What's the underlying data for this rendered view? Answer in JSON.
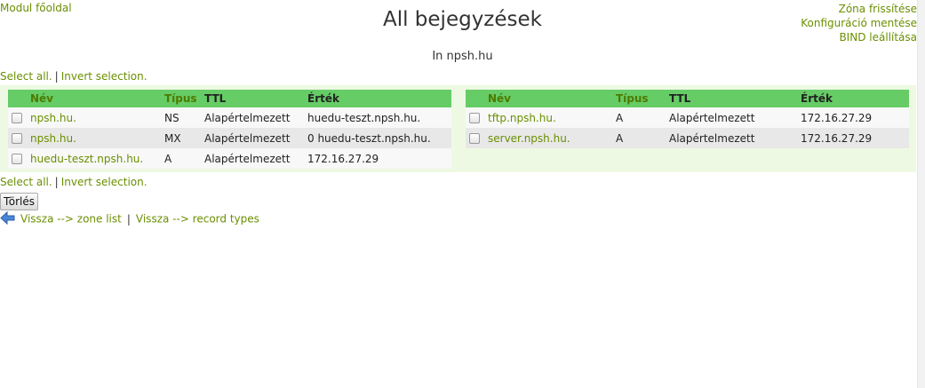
{
  "header": {
    "module_home": "Modul főoldal",
    "title": "All bejegyzések",
    "subtitle": "In npsh.hu",
    "actions": [
      "Zóna frissítése",
      "Konfiguráció mentése",
      "BIND leállítása"
    ]
  },
  "selection": {
    "select_all": "Select all.",
    "separator": "|",
    "invert": "Invert selection."
  },
  "columns": {
    "name": "Név",
    "type": "Típus",
    "ttl": "TTL",
    "value": "Érték"
  },
  "left_records": [
    {
      "name": "npsh.hu.",
      "type": "NS",
      "ttl": "Alapértelmezett",
      "value": "huedu-teszt.npsh.hu."
    },
    {
      "name": "npsh.hu.",
      "type": "MX",
      "ttl": "Alapértelmezett",
      "value": "0 huedu-teszt.npsh.hu."
    },
    {
      "name": "huedu-teszt.npsh.hu.",
      "type": "A",
      "ttl": "Alapértelmezett",
      "value": "172.16.27.29"
    }
  ],
  "right_records": [
    {
      "name": "tftp.npsh.hu.",
      "type": "A",
      "ttl": "Alapértelmezett",
      "value": "172.16.27.29"
    },
    {
      "name": "server.npsh.hu.",
      "type": "A",
      "ttl": "Alapértelmezett",
      "value": "172.16.27.29"
    }
  ],
  "delete_button": "Törlés",
  "back": {
    "zone_list": "Vissza --> zone list",
    "separator": "|",
    "record_types": "Vissza --> record types"
  },
  "colors": {
    "link": "#6a8f00",
    "header_bg": "#66cc66",
    "panel_bg": "#eef9e3"
  },
  "icons": {
    "back": "back-arrow-icon"
  }
}
